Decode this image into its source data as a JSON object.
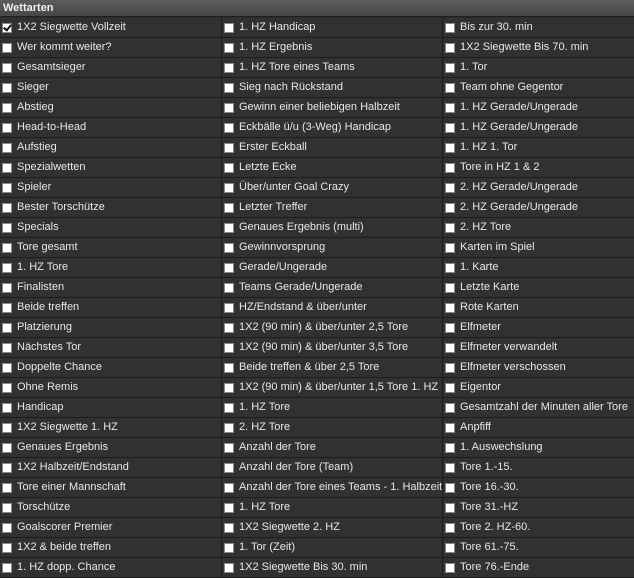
{
  "header": {
    "title": "Wettarten"
  },
  "options": [
    {
      "label": "1X2 Siegwette Vollzeit",
      "checked": true
    },
    {
      "label": "1. HZ Handicap",
      "checked": false
    },
    {
      "label": "Bis zur 30. min",
      "checked": false
    },
    {
      "label": "Wer kommt weiter?",
      "checked": false
    },
    {
      "label": "1. HZ Ergebnis",
      "checked": false
    },
    {
      "label": "1X2 Siegwette Bis 70. min",
      "checked": false
    },
    {
      "label": "Gesamtsieger",
      "checked": false
    },
    {
      "label": "1. HZ Tore eines Teams",
      "checked": false
    },
    {
      "label": "1. Tor",
      "checked": false
    },
    {
      "label": "Sieger",
      "checked": false
    },
    {
      "label": "Sieg nach Rückstand",
      "checked": false
    },
    {
      "label": "Team ohne Gegentor",
      "checked": false
    },
    {
      "label": "Abstieg",
      "checked": false
    },
    {
      "label": "Gewinn einer beliebigen Halbzeit",
      "checked": false
    },
    {
      "label": "1. HZ Gerade/Ungerade",
      "checked": false
    },
    {
      "label": "Head-to-Head",
      "checked": false
    },
    {
      "label": "Eckbälle ü/u (3-Weg) Handicap",
      "checked": false
    },
    {
      "label": "1. HZ Gerade/Ungerade",
      "checked": false
    },
    {
      "label": "Aufstieg",
      "checked": false
    },
    {
      "label": "Erster Eckball",
      "checked": false
    },
    {
      "label": "1. HZ 1. Tor",
      "checked": false
    },
    {
      "label": "Spezialwetten",
      "checked": false
    },
    {
      "label": "Letzte Ecke",
      "checked": false
    },
    {
      "label": "Tore in HZ 1 & 2",
      "checked": false
    },
    {
      "label": "Spieler",
      "checked": false
    },
    {
      "label": "Über/unter Goal Crazy",
      "checked": false
    },
    {
      "label": "2. HZ Gerade/Ungerade",
      "checked": false
    },
    {
      "label": "Bester Torschütze",
      "checked": false
    },
    {
      "label": "Letzter Treffer",
      "checked": false
    },
    {
      "label": "2. HZ Gerade/Ungerade",
      "checked": false
    },
    {
      "label": "Specials",
      "checked": false
    },
    {
      "label": "Genaues Ergebnis (multi)",
      "checked": false
    },
    {
      "label": "2. HZ Tore",
      "checked": false
    },
    {
      "label": "Tore gesamt",
      "checked": false
    },
    {
      "label": "Gewinnvorsprung",
      "checked": false
    },
    {
      "label": "Karten im Spiel",
      "checked": false
    },
    {
      "label": "1. HZ Tore",
      "checked": false
    },
    {
      "label": "Gerade/Ungerade",
      "checked": false
    },
    {
      "label": "1. Karte",
      "checked": false
    },
    {
      "label": "Finalisten",
      "checked": false
    },
    {
      "label": "Teams Gerade/Ungerade",
      "checked": false
    },
    {
      "label": "Letzte Karte",
      "checked": false
    },
    {
      "label": "Beide treffen",
      "checked": false
    },
    {
      "label": "HZ/Endstand & über/unter",
      "checked": false
    },
    {
      "label": "Rote Karten",
      "checked": false
    },
    {
      "label": "Platzierung",
      "checked": false
    },
    {
      "label": "1X2 (90 min) & über/unter 2,5 Tore",
      "checked": false
    },
    {
      "label": "Elfmeter",
      "checked": false
    },
    {
      "label": "Nächstes Tor",
      "checked": false
    },
    {
      "label": "1X2 (90 min) & über/unter 3,5 Tore",
      "checked": false
    },
    {
      "label": "Elfmeter verwandelt",
      "checked": false
    },
    {
      "label": "Doppelte Chance",
      "checked": false
    },
    {
      "label": "Beide treffen & über 2,5 Tore",
      "checked": false
    },
    {
      "label": "Elfmeter verschossen",
      "checked": false
    },
    {
      "label": "Ohne Remis",
      "checked": false
    },
    {
      "label": "1X2 (90 min) & über/unter 1,5 Tore 1. HZ",
      "checked": false
    },
    {
      "label": "Eigentor",
      "checked": false
    },
    {
      "label": "Handicap",
      "checked": false
    },
    {
      "label": "1. HZ Tore",
      "checked": false
    },
    {
      "label": "Gesamtzahl der Minuten aller Tore",
      "checked": false
    },
    {
      "label": "1X2 Siegwette 1. HZ",
      "checked": false
    },
    {
      "label": "2. HZ Tore",
      "checked": false
    },
    {
      "label": "Anpfiff",
      "checked": false
    },
    {
      "label": "Genaues Ergebnis",
      "checked": false
    },
    {
      "label": "Anzahl der Tore",
      "checked": false
    },
    {
      "label": "1. Auswechslung",
      "checked": false
    },
    {
      "label": "1X2 Halbzeit/Endstand",
      "checked": false
    },
    {
      "label": "Anzahl der Tore (Team)",
      "checked": false
    },
    {
      "label": "Tore 1.-15.",
      "checked": false
    },
    {
      "label": "Tore einer Mannschaft",
      "checked": false
    },
    {
      "label": "Anzahl der Tore eines Teams - 1. Halbzeit",
      "checked": false
    },
    {
      "label": "Tore 16.-30.",
      "checked": false
    },
    {
      "label": "Torschütze",
      "checked": false
    },
    {
      "label": "1. HZ Tore",
      "checked": false
    },
    {
      "label": "Tore 31.-HZ",
      "checked": false
    },
    {
      "label": "Goalscorer Premier",
      "checked": false
    },
    {
      "label": "1X2 Siegwette 2. HZ",
      "checked": false
    },
    {
      "label": "Tore 2. HZ-60.",
      "checked": false
    },
    {
      "label": "1X2 & beide treffen",
      "checked": false
    },
    {
      "label": "1. Tor (Zeit)",
      "checked": false
    },
    {
      "label": "Tore 61.-75.",
      "checked": false
    },
    {
      "label": "1. HZ dopp. Chance",
      "checked": false
    },
    {
      "label": "1X2 Siegwette Bis 30. min",
      "checked": false
    },
    {
      "label": "Tore 76.-Ende",
      "checked": false
    }
  ]
}
